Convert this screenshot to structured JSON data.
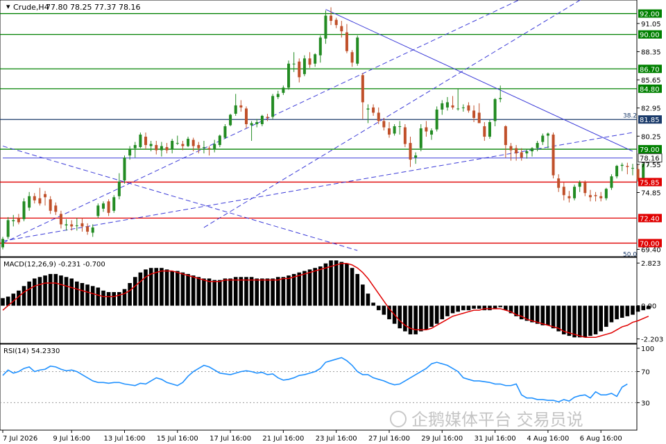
{
  "chart_data": [
    {
      "type": "candlestick",
      "panel": "price",
      "title": "Crude,H4",
      "ohlc_header": "77.80 78.25 77.37 78.16",
      "y_ticks": [
        "91.05",
        "88.35",
        "85.65",
        "82.95",
        "80.25",
        "77.55",
        "74.85",
        "69.40"
      ],
      "ylim": [
        68.7,
        93.3
      ],
      "current_price": 78.16,
      "current_price_label": "78.16",
      "levels": [
        {
          "value": 92.0,
          "label": "92.00",
          "color": "#008000"
        },
        {
          "value": 90.0,
          "label": "90.00",
          "color": "#008000"
        },
        {
          "value": 86.7,
          "label": "86.70",
          "color": "#008000"
        },
        {
          "value": 84.8,
          "label": "84.80",
          "color": "#008000"
        },
        {
          "value": 81.85,
          "label": "81.85",
          "color": "#1a3a6a"
        },
        {
          "value": 79.0,
          "label": "79.00",
          "color": "#008000"
        },
        {
          "value": 75.85,
          "label": "75.85",
          "color": "#e00000"
        },
        {
          "value": 72.4,
          "label": "72.40",
          "color": "#e00000"
        },
        {
          "value": 70.0,
          "label": "70.00",
          "color": "#e00000"
        }
      ],
      "fib_labels": [
        {
          "text": "38.2",
          "value": 82.3
        },
        {
          "text": "50.0",
          "value": 69.0
        }
      ],
      "trendlines": [
        {
          "style": "dashed",
          "from": [
            0,
            70.0
          ],
          "to": [
            113,
            97.0
          ]
        },
        {
          "style": "dashed",
          "from": [
            38,
            71.5
          ],
          "to": [
            113,
            94.5
          ]
        },
        {
          "style": "dashed",
          "from": [
            0,
            79.3
          ],
          "to": [
            67,
            69.3
          ]
        },
        {
          "style": "dashed",
          "from": [
            0,
            70.2
          ],
          "to": [
            119,
            80.6
          ]
        },
        {
          "style": "solid",
          "from": [
            61,
            92.4
          ],
          "to": [
            119,
            78.8
          ]
        },
        {
          "style": "solid",
          "from": [
            0,
            78.16
          ],
          "to": [
            119,
            78.16
          ]
        }
      ],
      "candles": [
        [
          69.6,
          70.6,
          69.4,
          70.4
        ],
        [
          70.6,
          72.5,
          70.4,
          72.2
        ],
        [
          72.1,
          72.7,
          71.6,
          72.2
        ],
        [
          72.4,
          72.8,
          71.8,
          72.0
        ],
        [
          72.3,
          74.3,
          72.1,
          74.0
        ],
        [
          73.4,
          74.9,
          73.1,
          74.5
        ],
        [
          74.5,
          74.8,
          73.8,
          74.1
        ],
        [
          74.3,
          75.3,
          73.6,
          73.8
        ],
        [
          74.7,
          75.0,
          73.6,
          74.4
        ],
        [
          74.2,
          74.5,
          72.8,
          73.1
        ],
        [
          73.6,
          73.9,
          72.7,
          73.0
        ],
        [
          72.8,
          73.1,
          71.4,
          71.8
        ],
        [
          71.7,
          72.3,
          71.2,
          71.8
        ],
        [
          71.8,
          72.2,
          71.2,
          71.6
        ],
        [
          71.7,
          72.4,
          71.2,
          71.7
        ],
        [
          71.9,
          72.4,
          71.1,
          71.6
        ],
        [
          71.6,
          71.9,
          70.8,
          71.1
        ],
        [
          71.0,
          71.8,
          70.6,
          71.5
        ],
        [
          72.6,
          73.8,
          72.4,
          73.6
        ],
        [
          73.3,
          74.0,
          73.0,
          73.8
        ],
        [
          74.0,
          74.2,
          72.6,
          72.9
        ],
        [
          73.1,
          74.6,
          72.9,
          74.4
        ],
        [
          74.5,
          76.7,
          74.2,
          75.9
        ],
        [
          76.0,
          78.4,
          75.7,
          78.2
        ],
        [
          78.4,
          79.3,
          78.0,
          79.0
        ],
        [
          79.1,
          79.7,
          78.2,
          79.4
        ],
        [
          79.2,
          80.6,
          79.1,
          80.4
        ],
        [
          80.2,
          80.6,
          79.0,
          79.4
        ],
        [
          79.3,
          79.8,
          78.8,
          79.5
        ],
        [
          79.4,
          79.8,
          78.5,
          78.9
        ],
        [
          78.9,
          79.7,
          78.3,
          79.3
        ],
        [
          79.2,
          79.6,
          78.6,
          78.9
        ],
        [
          79.0,
          80.0,
          78.6,
          79.8
        ],
        [
          79.6,
          80.3,
          79.4,
          79.6
        ],
        [
          79.5,
          79.8,
          78.9,
          79.3
        ],
        [
          79.3,
          80.2,
          79.2,
          80.0
        ],
        [
          79.9,
          80.1,
          78.8,
          79.3
        ],
        [
          79.4,
          79.7,
          78.6,
          79.1
        ],
        [
          79.2,
          79.8,
          78.6,
          79.2
        ],
        [
          79.1,
          79.3,
          78.4,
          79.0
        ],
        [
          79.0,
          79.9,
          78.7,
          79.5
        ],
        [
          79.4,
          80.4,
          79.2,
          80.3
        ],
        [
          80.1,
          81.4,
          80.0,
          81.2
        ],
        [
          81.3,
          82.4,
          81.2,
          82.3
        ],
        [
          82.4,
          84.3,
          82.2,
          83.2
        ],
        [
          83.2,
          83.7,
          82.6,
          83.0
        ],
        [
          82.9,
          83.1,
          81.0,
          81.4
        ],
        [
          81.3,
          81.7,
          79.8,
          81.5
        ],
        [
          81.4,
          81.9,
          81.1,
          81.6
        ],
        [
          81.4,
          82.3,
          81.2,
          82.2
        ],
        [
          82.1,
          82.4,
          81.7,
          82.0
        ],
        [
          82.1,
          84.3,
          81.9,
          84.1
        ],
        [
          84.0,
          84.6,
          83.8,
          84.3
        ],
        [
          84.4,
          85.1,
          84.2,
          84.9
        ],
        [
          84.9,
          87.5,
          84.7,
          87.2
        ],
        [
          87.2,
          88.3,
          86.4,
          87.2
        ],
        [
          87.4,
          87.7,
          85.4,
          85.9
        ],
        [
          86.2,
          88.0,
          86.0,
          87.7
        ],
        [
          87.7,
          88.3,
          86.8,
          87.1
        ],
        [
          87.2,
          88.2,
          86.9,
          88.1
        ],
        [
          88.0,
          89.9,
          87.3,
          89.7
        ],
        [
          89.6,
          92.3,
          89.1,
          91.8
        ],
        [
          91.8,
          92.6,
          90.9,
          91.3
        ],
        [
          91.4,
          91.6,
          90.6,
          90.9
        ],
        [
          90.8,
          91.3,
          89.7,
          90.3
        ],
        [
          90.2,
          91.0,
          88.2,
          88.4
        ],
        [
          88.3,
          88.5,
          86.9,
          87.3
        ],
        [
          87.2,
          89.9,
          87.0,
          89.7
        ],
        [
          86.1,
          86.3,
          81.9,
          83.5
        ],
        [
          82.8,
          83.3,
          81.5,
          82.9
        ],
        [
          83.0,
          83.3,
          82.2,
          82.5
        ],
        [
          82.5,
          83.0,
          81.4,
          81.7
        ],
        [
          81.7,
          82.0,
          80.8,
          81.1
        ],
        [
          81.0,
          81.6,
          80.1,
          80.4
        ],
        [
          80.5,
          81.4,
          80.3,
          81.2
        ],
        [
          81.2,
          81.7,
          80.4,
          81.2
        ],
        [
          81.1,
          81.4,
          79.2,
          79.5
        ],
        [
          79.6,
          80.2,
          77.3,
          78.0
        ],
        [
          78.2,
          78.7,
          77.6,
          78.4
        ],
        [
          79.1,
          81.4,
          78.8,
          81.0
        ],
        [
          81.1,
          81.7,
          80.2,
          80.7
        ],
        [
          80.4,
          81.0,
          79.9,
          80.8
        ],
        [
          80.9,
          83.1,
          80.7,
          82.8
        ],
        [
          82.8,
          83.7,
          82.3,
          83.4
        ],
        [
          83.0,
          84.0,
          82.7,
          83.5
        ],
        [
          83.2,
          84.1,
          82.8,
          83.0
        ],
        [
          82.9,
          84.8,
          82.7,
          82.9
        ],
        [
          83.0,
          83.3,
          82.6,
          83.0
        ],
        [
          83.2,
          83.5,
          82.5,
          82.7
        ],
        [
          82.7,
          83.2,
          81.6,
          82.0
        ],
        [
          82.5,
          83.4,
          81.7,
          81.5
        ],
        [
          81.2,
          81.6,
          79.8,
          80.2
        ],
        [
          80.2,
          81.8,
          80.0,
          81.6
        ],
        [
          81.7,
          83.9,
          81.2,
          83.8
        ],
        [
          83.8,
          85.1,
          83.5,
          83.9
        ],
        [
          81.2,
          81.3,
          78.2,
          79.4
        ],
        [
          79.3,
          79.6,
          77.9,
          78.9
        ],
        [
          79.1,
          79.4,
          77.9,
          78.6
        ],
        [
          78.7,
          79.1,
          77.9,
          78.2
        ],
        [
          78.6,
          79.0,
          78.1,
          78.8
        ],
        [
          78.8,
          79.2,
          78.3,
          79.1
        ],
        [
          79.1,
          79.8,
          78.8,
          79.6
        ],
        [
          79.7,
          80.5,
          79.4,
          80.3
        ],
        [
          80.3,
          80.6,
          79.1,
          80.5
        ],
        [
          80.4,
          80.6,
          76.2,
          76.5
        ],
        [
          76.2,
          76.6,
          74.9,
          75.3
        ],
        [
          75.4,
          75.8,
          74.1,
          74.6
        ],
        [
          74.5,
          75.0,
          73.9,
          74.3
        ],
        [
          74.3,
          75.6,
          74.1,
          75.4
        ],
        [
          75.4,
          76.0,
          74.9,
          75.8
        ],
        [
          75.8,
          76.0,
          74.5,
          74.8
        ],
        [
          74.6,
          75.1,
          74.0,
          74.4
        ],
        [
          74.6,
          74.9,
          74.0,
          74.5
        ],
        [
          74.5,
          74.9,
          74.0,
          74.3
        ],
        [
          74.3,
          75.3,
          74.1,
          75.2
        ],
        [
          75.3,
          76.6,
          75.1,
          76.4
        ],
        [
          76.4,
          77.5,
          76.2,
          77.4
        ],
        [
          77.4,
          77.7,
          76.9,
          77.5
        ],
        [
          77.4,
          77.7,
          76.6,
          77.3
        ],
        [
          77.2,
          77.6,
          76.5,
          77.2
        ],
        [
          77.1,
          77.5,
          75.9,
          76.1
        ],
        [
          76.2,
          77.7,
          76.0,
          77.6
        ],
        [
          77.8,
          78.25,
          77.37,
          78.16
        ]
      ]
    },
    {
      "type": "bar",
      "panel": "macd",
      "title": "MACD(12,26,9) -0.231 -0.700",
      "y_ticks": [
        "2.823",
        "0.00",
        "-2.203"
      ],
      "ylim": [
        -2.5,
        3.2
      ],
      "histogram": [
        0.5,
        0.6,
        0.8,
        1.0,
        1.3,
        1.6,
        1.8,
        1.9,
        2.0,
        2.1,
        2.1,
        2.0,
        1.9,
        1.8,
        1.6,
        1.5,
        1.4,
        1.3,
        1.2,
        1.0,
        0.9,
        0.9,
        0.9,
        1.1,
        1.5,
        1.9,
        2.2,
        2.4,
        2.5,
        2.5,
        2.5,
        2.4,
        2.3,
        2.3,
        2.2,
        2.1,
        2.0,
        1.9,
        1.8,
        1.8,
        1.7,
        1.7,
        1.8,
        1.8,
        1.9,
        1.9,
        1.9,
        1.9,
        1.8,
        1.8,
        1.8,
        1.8,
        1.9,
        1.9,
        2.0,
        2.1,
        2.2,
        2.3,
        2.4,
        2.5,
        2.6,
        2.8,
        3.0,
        3.0,
        2.9,
        2.8,
        2.5,
        2.1,
        1.4,
        0.8,
        0.2,
        -0.3,
        -0.6,
        -0.9,
        -1.2,
        -1.5,
        -1.7,
        -1.9,
        -1.9,
        -1.7,
        -1.6,
        -1.4,
        -1.2,
        -0.9,
        -0.7,
        -0.5,
        -0.4,
        -0.3,
        -0.3,
        -0.2,
        -0.2,
        -0.3,
        -0.3,
        -0.2,
        -0.1,
        -0.3,
        -0.5,
        -0.7,
        -0.9,
        -1.0,
        -1.1,
        -1.2,
        -1.3,
        -1.3,
        -1.5,
        -1.7,
        -1.9,
        -2.0,
        -2.1,
        -2.1,
        -2.1,
        -2.0,
        -1.9,
        -1.7,
        -1.4,
        -1.1,
        -0.9,
        -0.8,
        -0.7,
        -0.6,
        -0.4,
        -0.3,
        -0.23
      ],
      "signal": [
        -0.3,
        0.0,
        0.3,
        0.6,
        0.9,
        1.1,
        1.3,
        1.4,
        1.5,
        1.5,
        1.5,
        1.4,
        1.3,
        1.2,
        1.1,
        1.0,
        0.9,
        0.8,
        0.7,
        0.6,
        0.6,
        0.6,
        0.7,
        0.8,
        1.0,
        1.3,
        1.6,
        1.9,
        2.1,
        2.2,
        2.3,
        2.3,
        2.3,
        2.2,
        2.1,
        2.0,
        1.9,
        1.8,
        1.7,
        1.6,
        1.6,
        1.6,
        1.7,
        1.7,
        1.7,
        1.7,
        1.7,
        1.7,
        1.7,
        1.7,
        1.7,
        1.7,
        1.7,
        1.8,
        1.8,
        1.9,
        2.0,
        2.1,
        2.2,
        2.3,
        2.4,
        2.5,
        2.6,
        2.7,
        2.8,
        2.8,
        2.7,
        2.5,
        2.2,
        1.8,
        1.3,
        0.8,
        0.3,
        -0.2,
        -0.6,
        -1.0,
        -1.3,
        -1.5,
        -1.6,
        -1.6,
        -1.6,
        -1.5,
        -1.3,
        -1.1,
        -0.9,
        -0.7,
        -0.6,
        -0.5,
        -0.4,
        -0.3,
        -0.3,
        -0.2,
        -0.2,
        -0.2,
        -0.2,
        -0.3,
        -0.4,
        -0.6,
        -0.7,
        -0.9,
        -1.0,
        -1.1,
        -1.2,
        -1.3,
        -1.4,
        -1.5,
        -1.7,
        -1.8,
        -1.9,
        -2.0,
        -2.1,
        -2.1,
        -2.1,
        -2.0,
        -1.9,
        -1.8,
        -1.6,
        -1.4,
        -1.3,
        -1.1,
        -1.0,
        -0.85,
        -0.7
      ]
    },
    {
      "type": "line",
      "panel": "rsi",
      "title": "RSI(14) 54.2330",
      "y_ticks": [
        "100",
        "70",
        "30"
      ],
      "ylim": [
        0,
        100
      ],
      "levels": [
        70,
        30
      ],
      "values": [
        65,
        72,
        68,
        70,
        74,
        76,
        70,
        72,
        73,
        77,
        76,
        73,
        71,
        72,
        70,
        66,
        62,
        58,
        56,
        56,
        55,
        56,
        56,
        54,
        53,
        52,
        55,
        54,
        58,
        62,
        60,
        56,
        54,
        52,
        56,
        64,
        70,
        74,
        78,
        76,
        72,
        68,
        67,
        66,
        68,
        70,
        71,
        70,
        68,
        69,
        66,
        67,
        62,
        59,
        60,
        62,
        65,
        66,
        68,
        70,
        74,
        82,
        84,
        86,
        88,
        84,
        78,
        70,
        66,
        66,
        62,
        60,
        58,
        55,
        53,
        54,
        58,
        62,
        66,
        70,
        74,
        80,
        82,
        80,
        78,
        74,
        70,
        62,
        60,
        58,
        58,
        57,
        56,
        54,
        54,
        52,
        52,
        54,
        40,
        36,
        36,
        34,
        34,
        33,
        33,
        31,
        34,
        32,
        37,
        39,
        40,
        36,
        44,
        40,
        40,
        42,
        38,
        50,
        54
      ]
    },
    {
      "type": "axis",
      "panel": "time",
      "x_labels": [
        {
          "text": "7 Jul 2026",
          "index": 0
        },
        {
          "text": "9 Jul 16:00",
          "index": 13
        },
        {
          "text": "13 Jul 16:00",
          "index": 23
        },
        {
          "text": "15 Jul 16:00",
          "index": 33
        },
        {
          "text": "17 Jul 16:00",
          "index": 43
        },
        {
          "text": "21 Jul 16:00",
          "index": 53
        },
        {
          "text": "23 Jul 16:00",
          "index": 63
        },
        {
          "text": "27 Jul 16:00",
          "index": 73
        },
        {
          "text": "29 Jul 16:00",
          "index": 83
        },
        {
          "text": "31 Jul 16:00",
          "index": 93
        },
        {
          "text": "4 Aug 16:00",
          "index": 103
        },
        {
          "text": "6 Aug 16:00",
          "index": 113
        }
      ]
    }
  ],
  "watermark": "企鹅媒体平台 交易员说",
  "colors": {
    "bull": "#228b22",
    "bear": "#c0502a",
    "support": "#e00000",
    "resistance": "#008000",
    "trend": "#3a3ad8",
    "macd_hist": "#000000",
    "macd_signal": "#e00000",
    "rsi_line": "#1e90ff"
  }
}
